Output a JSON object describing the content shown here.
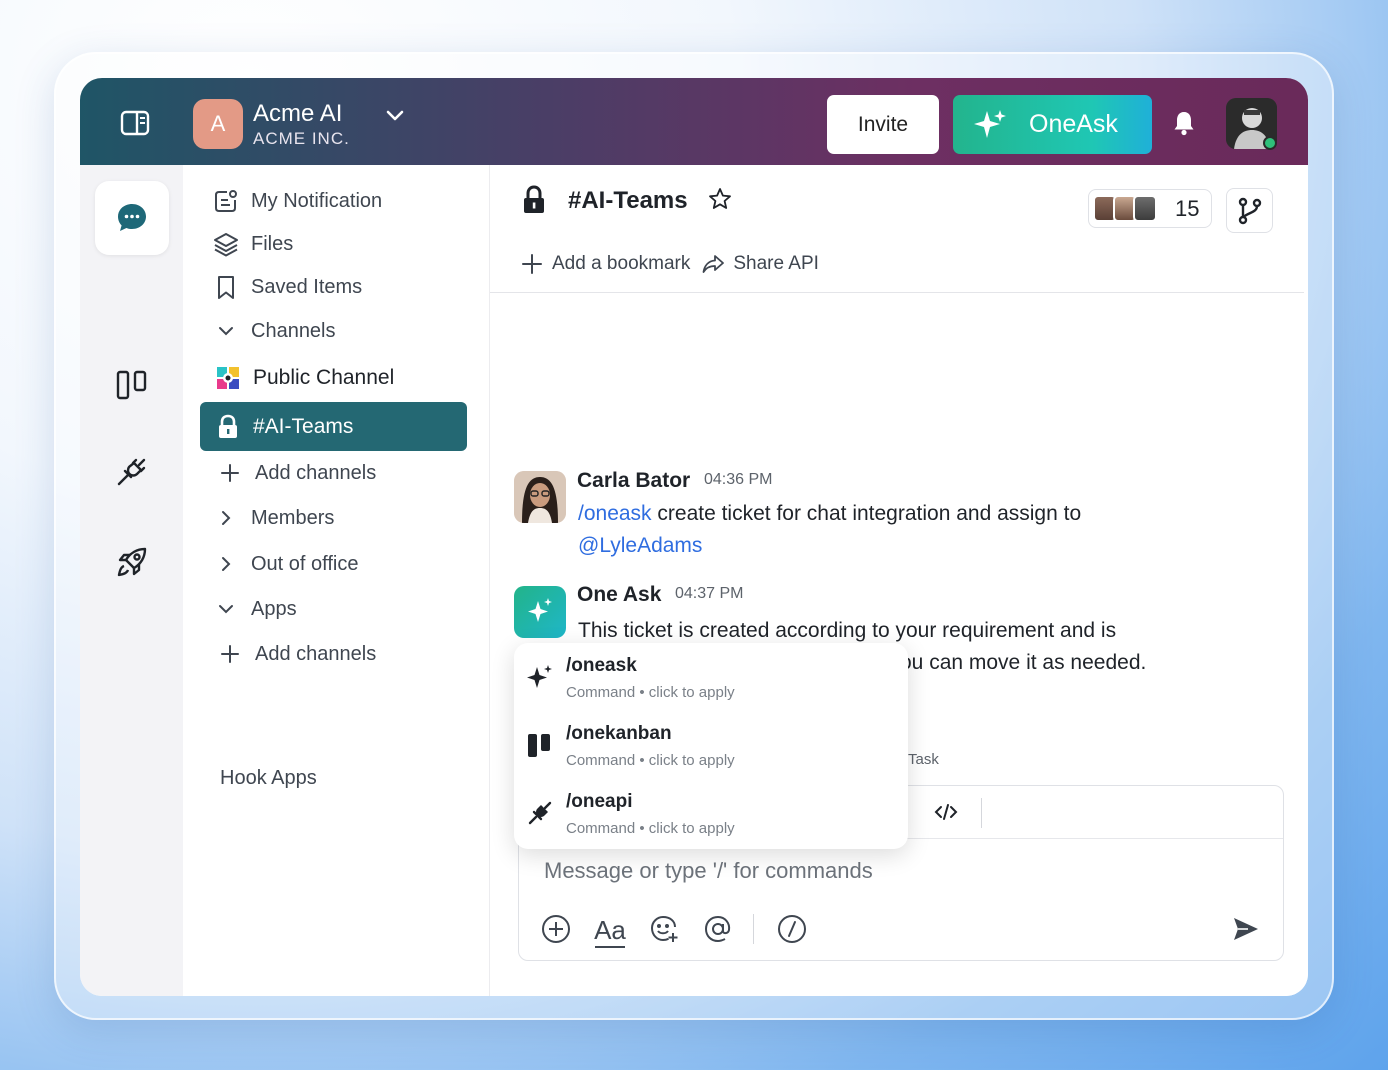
{
  "workspace": {
    "initial": "A",
    "name": "Acme AI",
    "company": "ACME INC."
  },
  "header": {
    "invite_label": "Invite",
    "oneask_label": "OneAsk"
  },
  "sidebar": {
    "items": [
      {
        "label": "My Notification"
      },
      {
        "label": "Files"
      },
      {
        "label": "Saved Items"
      },
      {
        "label": "Channels"
      },
      {
        "label": "Public Channel"
      },
      {
        "label": "#AI-Teams"
      },
      {
        "label": "Add channels"
      },
      {
        "label": "Members"
      },
      {
        "label": "Out of office"
      },
      {
        "label": "Apps"
      },
      {
        "label": "Add channels"
      },
      {
        "label": "Hook Apps"
      }
    ]
  },
  "channel": {
    "title": "#AI-Teams",
    "member_count": "15",
    "add_bookmark": "Add a bookmark",
    "share_api": "Share API"
  },
  "messages": [
    {
      "author": "Carla Bator",
      "time": "04:36 PM",
      "command": "/oneask",
      "text": " create ticket for chat integration and assign to",
      "mention": "@LyleAdams"
    },
    {
      "author": "One Ask",
      "time": "04:37 PM",
      "line1": "This ticket is created according to your requirement and is",
      "line2_visible": "ou can move it as needed.",
      "partial_label": "Task"
    }
  ],
  "composer": {
    "placeholder": "Message or type '/' for commands"
  },
  "commands": [
    {
      "name": "/oneask",
      "type": "Command",
      "hint": "click to apply"
    },
    {
      "name": "/onekanban",
      "type": "Command",
      "hint": "click to apply"
    },
    {
      "name": "/oneapi",
      "type": "Command",
      "hint": "click to apply"
    }
  ],
  "colors": {
    "active_channel": "#246873",
    "oneask_gradient_start": "#23b48d",
    "mention": "#2f6de0",
    "online": "#2fbf7a"
  }
}
